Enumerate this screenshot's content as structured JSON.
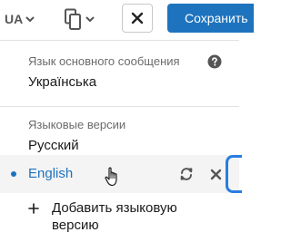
{
  "toolbar": {
    "language_code": "UA",
    "save_label": "Сохранить"
  },
  "panel": {
    "primary_label": "Язык основного сообщения",
    "primary_value": "Українська",
    "versions_label": "Языковые версии",
    "versions": [
      {
        "label": "Русский",
        "active": false
      },
      {
        "label": "English",
        "active": true
      }
    ],
    "add_label": "Добавить языковую версию"
  },
  "colors": {
    "accent": "#1e73be",
    "muted_text": "#6b6b6b",
    "active_row_bg": "#f4f4f4"
  },
  "icons": {
    "language_dropdown": "chevron-down-icon",
    "device": "tablet-icon",
    "close": "close-icon",
    "help": "question-circle-icon",
    "sync": "sync-icon",
    "remove": "close-icon",
    "add": "plus-icon",
    "cursor": "hand-pointer-icon"
  }
}
